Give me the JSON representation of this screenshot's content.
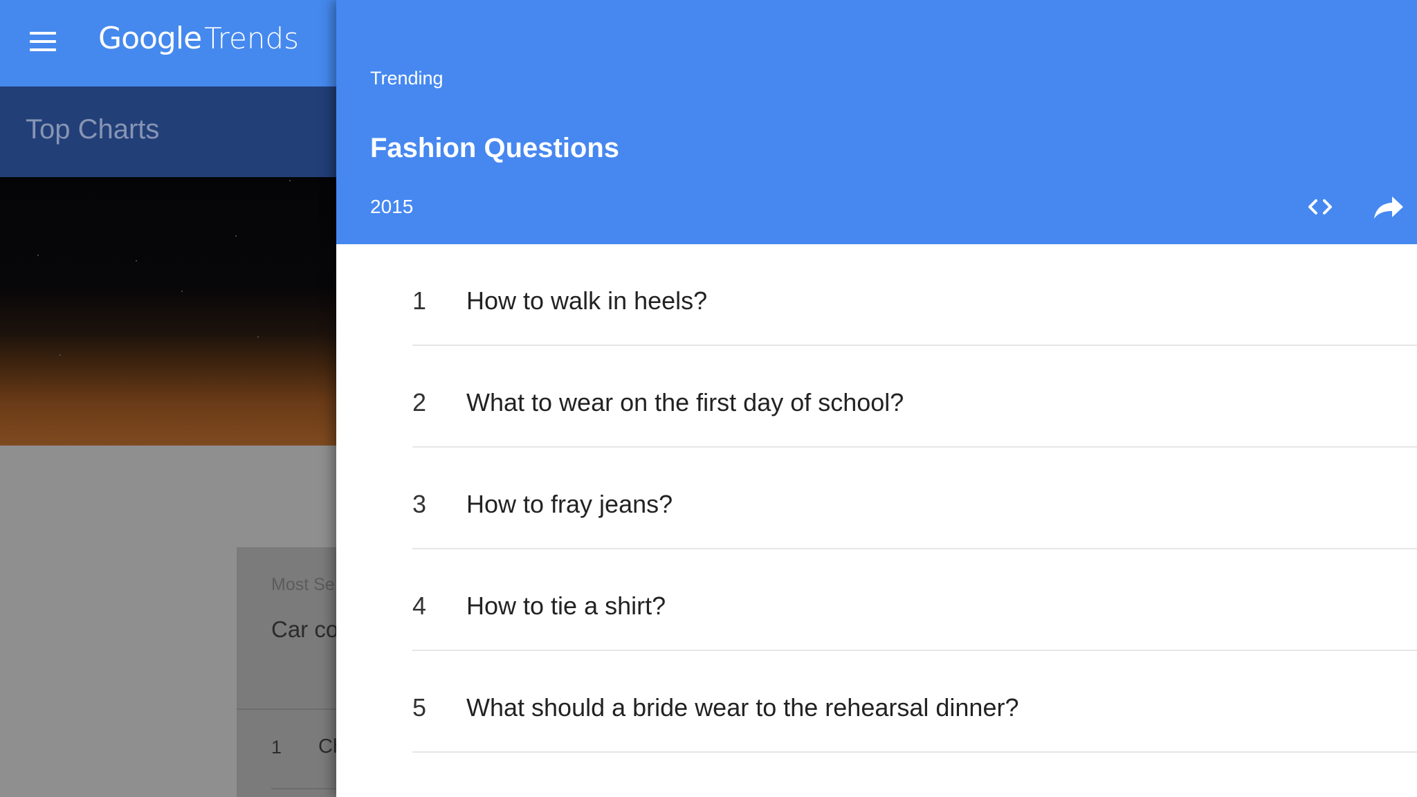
{
  "app": {
    "logo_google": "Google",
    "logo_trends": "Trends"
  },
  "sidebar": {
    "title": "Top Charts"
  },
  "background_card": {
    "label": "Most Se",
    "title": "Car co",
    "first_rank": "1",
    "first_item": "Ch"
  },
  "chart": {
    "eyebrow": "Trending",
    "title": "Fashion Questions",
    "year": "2015",
    "items": [
      {
        "rank": "1",
        "text": "How to walk in heels?"
      },
      {
        "rank": "2",
        "text": "What to wear on the first day of school?"
      },
      {
        "rank": "3",
        "text": "How to fray jeans?"
      },
      {
        "rank": "4",
        "text": "How to tie a shirt?"
      },
      {
        "rank": "5",
        "text": "What should a bride wear to the rehearsal dinner?"
      }
    ]
  },
  "icons": {
    "menu": "menu-icon",
    "embed": "code-icon",
    "share": "share-arrow-icon"
  },
  "colors": {
    "header_blue": "#4688f0",
    "topcharts_navy": "#223f78",
    "white": "#ffffff"
  }
}
